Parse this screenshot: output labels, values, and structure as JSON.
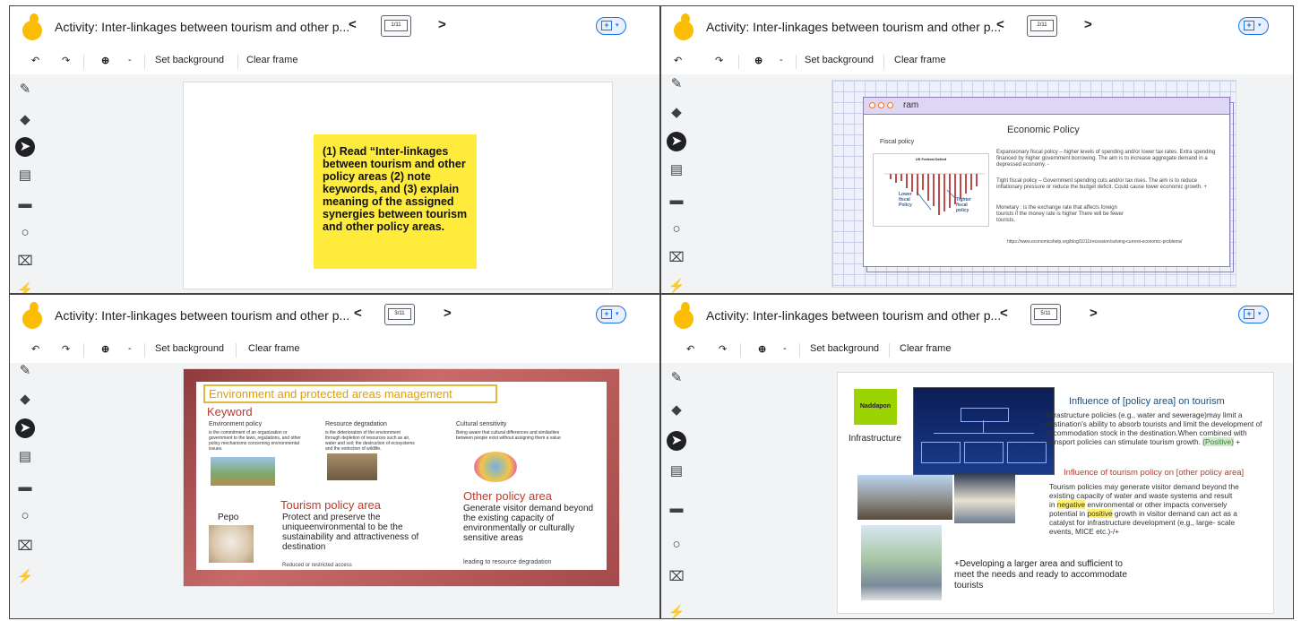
{
  "common": {
    "title": "Activity: Inter-linkages between tourism and other p...",
    "prev": "<",
    "next": ">",
    "set_background": "Set background",
    "clear_frame": "Clear frame",
    "zoom_caret": "-"
  },
  "q1": {
    "frame_counter": "1/11",
    "sticky_text": "(1) Read “Inter-linkages between tourism and other policy areas (2) note keywords, and (3) explain meaning of the assigned synergies between tourism and other policy areas."
  },
  "q2": {
    "frame_counter": "2/11",
    "window_title": "ram",
    "heading": "Economic Policy",
    "fiscal_label": "Fiscal policy",
    "chart_title": "US Federal Deficit",
    "lower_label": "Lower fiscal Policy",
    "tighter_label": "Tighter fiscal policy",
    "para1": "Expansionary fiscal policy – higher levels of spending and/or lower tax rates. Extra spending financed by higher government borrowing. The aim is to increase aggregate demand in a depressed economy. -",
    "para2": "Tight fiscal policy – Government spending cuts and/or tax rises. The aim is to reduce inflationary pressure or reduce the budget deficit. Could cause lower economic growth. +",
    "para3": "Monetary : is the exchange rate that affects foreign tourists if the money rate is higher There will be fewer tourists.",
    "url": "https://www.economicshelp.org/blog/1011/recession/solving-current-economic-problems/"
  },
  "q3": {
    "frame_counter": "3/11",
    "env_title": "Environment and protected areas management",
    "keyword": "Keyword",
    "col1_title": "Environment policy",
    "col1_text": "is the commitment of an organization or government to the laws, regulations, and other policy mechanisms concerning environmental issues.",
    "col2_title": "Resource degradation",
    "col2_text": "is the deterioration of the environment through depletion of resources such as air, water and soil; the destruction of ecosystems and the extinction of wildlife.",
    "col3_title": "Cultural sensitivity",
    "col3_text": "Being aware that cultural differences and similarities between people exist without assigning them a value",
    "tourism_heading": "Tourism policy area",
    "tourism_body": "Protect and preserve the uniqueenvironmental to be the sustainability and attractiveness of destination",
    "tourism_small": "Reduced or restricted access",
    "pepo": "Pepo",
    "other_heading": "Other policy area",
    "other_body": "Generate visitor demand beyond the existing capacity of environmentally or culturally sensitive areas",
    "other_small": "leading to resource degradation"
  },
  "q4": {
    "frame_counter": "5/11",
    "name_tag": "Naddapon",
    "infrastructure": "Infrastructure",
    "heading1": "Influence of [policy area] on tourism",
    "body1": "Infrastructure policies (e.g., water and sewerage)may limit a destination's ability to absorb tourists and limit the development of accommodation stock in the destination.When combined with transport policies can stimulate tourism growth.",
    "positive_tag": "(Positive)",
    "plus": "+",
    "heading2": "Influence of tourism policy on [other policy area]",
    "body2_a": "Tourism policies may generate visitor demand beyond the existing capacity of water and waste systems and result in",
    "negative": "negative",
    "body2_b": "environmental or other impacts conversely potential in",
    "positive": "positive",
    "body2_c": "growth in visitor demand can act as a catalyst for infrastructure development (e.g., large- scale events, MICE etc.)-/+",
    "bottom_text": "+Developing a larger area and sufficient to meet the needs and ready to accommodate tourists"
  }
}
